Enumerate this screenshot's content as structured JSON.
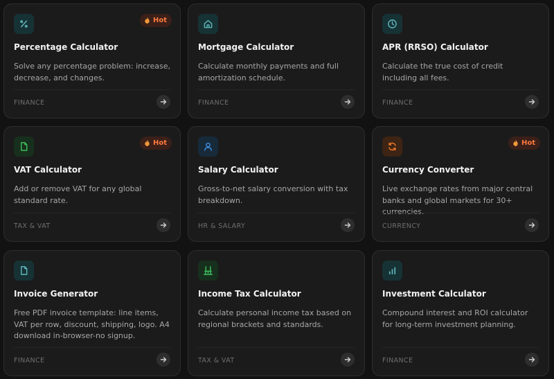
{
  "hot_label": "Hot",
  "colors": {
    "teal": "#5fb7bd",
    "green": "#3fbf5c",
    "blue": "#3f8fe0",
    "orange": "#f07a2a",
    "hot": "#ff7a3d"
  },
  "cards": [
    {
      "title": "Percentage Calculator",
      "desc": "Solve any percentage problem: increase, decrease, and changes.",
      "category": "FINANCE",
      "hot": true,
      "icon": "percent-icon"
    },
    {
      "title": "Mortgage Calculator",
      "desc": "Calculate monthly payments and full amortization schedule.",
      "category": "FINANCE",
      "hot": false,
      "icon": "home-icon"
    },
    {
      "title": "APR (RRSO) Calculator",
      "desc": "Calculate the true cost of credit including all fees.",
      "category": "FINANCE",
      "hot": false,
      "icon": "clock-icon"
    },
    {
      "title": "VAT Calculator",
      "desc": "Add or remove VAT for any global standard rate.",
      "category": "TAX & VAT",
      "hot": true,
      "icon": "document-icon"
    },
    {
      "title": "Salary Calculator",
      "desc": "Gross-to-net salary conversion with tax breakdown.",
      "category": "HR & SALARY",
      "hot": false,
      "icon": "user-icon"
    },
    {
      "title": "Currency Converter",
      "desc": "Live exchange rates from major central banks and global markets for 30+ currencies.",
      "category": "CURRENCY",
      "hot": true,
      "icon": "refresh-icon"
    },
    {
      "title": "Invoice Generator",
      "desc": "Free PDF invoice template: line items, VAT per row, discount, shipping, logo. A4 download in-browser-no signup.",
      "category": "FINANCE",
      "hot": false,
      "icon": "document-icon"
    },
    {
      "title": "Income Tax Calculator",
      "desc": "Calculate personal income tax based on regional brackets and standards.",
      "category": "TAX & VAT",
      "hot": false,
      "icon": "chair-icon"
    },
    {
      "title": "Investment Calculator",
      "desc": "Compound interest and ROI calculator for long-term investment planning.",
      "category": "FINANCE",
      "hot": false,
      "icon": "bar-chart-icon"
    }
  ]
}
